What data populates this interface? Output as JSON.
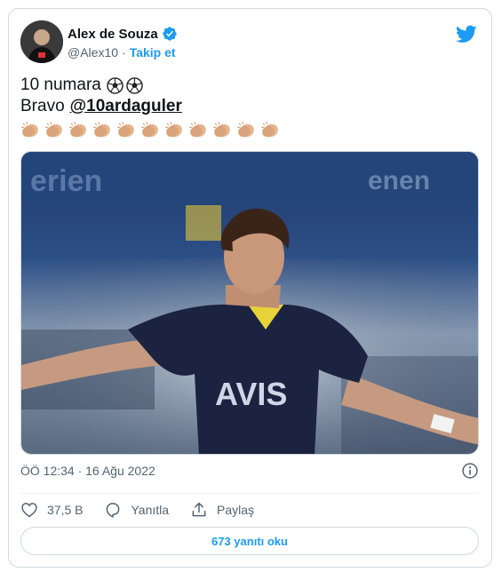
{
  "author": {
    "name": "Alex de Souza",
    "handle": "@Alex10",
    "separator": "·",
    "follow_label": "Takip et"
  },
  "tweet": {
    "line1": "10 numara",
    "line2_prefix": "Bravo",
    "mention": "@10ardaguler",
    "ball_emoji_count": 2,
    "clap_emoji_count": 11
  },
  "media": {
    "shirt_text": "AVIS"
  },
  "meta": {
    "timestamp": "ÖÖ 12:34 · 16 Ağu 2022"
  },
  "actions": {
    "like_count": "37,5 B",
    "reply_label": "Yanıtla",
    "share_label": "Paylaş"
  },
  "replies_button": {
    "label": "673 yanıtı oku"
  },
  "colors": {
    "accent": "#1d9bf0",
    "text": "#0f1419",
    "muted": "#536471",
    "border": "#cfd9de"
  }
}
